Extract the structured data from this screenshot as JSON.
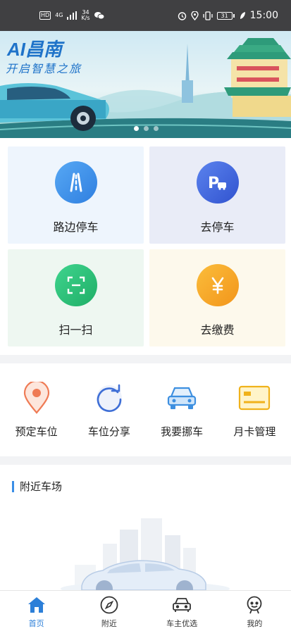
{
  "status_bar": {
    "hd": "HD",
    "network": "4G",
    "speed_value": "34",
    "speed_unit": "K/s",
    "battery": "31",
    "time": "15:00"
  },
  "banner": {
    "brand": "AI昌南",
    "slogan": "开启智慧之旅",
    "page_count": 3,
    "active_page": 1
  },
  "grid": [
    {
      "label": "路边停车",
      "icon": "road-icon"
    },
    {
      "label": "去停车",
      "icon": "parking-icon"
    },
    {
      "label": "扫一扫",
      "icon": "scan-icon"
    },
    {
      "label": "去缴费",
      "icon": "yen-icon"
    }
  ],
  "quick_actions": [
    {
      "label": "预定车位",
      "icon": "location-pin-icon"
    },
    {
      "label": "车位分享",
      "icon": "share-icon"
    },
    {
      "label": "我要挪车",
      "icon": "car-icon"
    },
    {
      "label": "月卡管理",
      "icon": "card-icon"
    }
  ],
  "nearby": {
    "title": "附近车场"
  },
  "tabs": [
    {
      "label": "首页",
      "icon": "home-icon",
      "active": true
    },
    {
      "label": "附近",
      "icon": "compass-icon",
      "active": false
    },
    {
      "label": "车主优选",
      "icon": "car-front-icon",
      "active": false
    },
    {
      "label": "我的",
      "icon": "user-icon",
      "active": false
    }
  ],
  "colors": {
    "accent": "#2c7fd8",
    "road": "#3a8ee6",
    "parking": "#3f63d6",
    "scan": "#28c07a",
    "yen": "#f5a623"
  }
}
